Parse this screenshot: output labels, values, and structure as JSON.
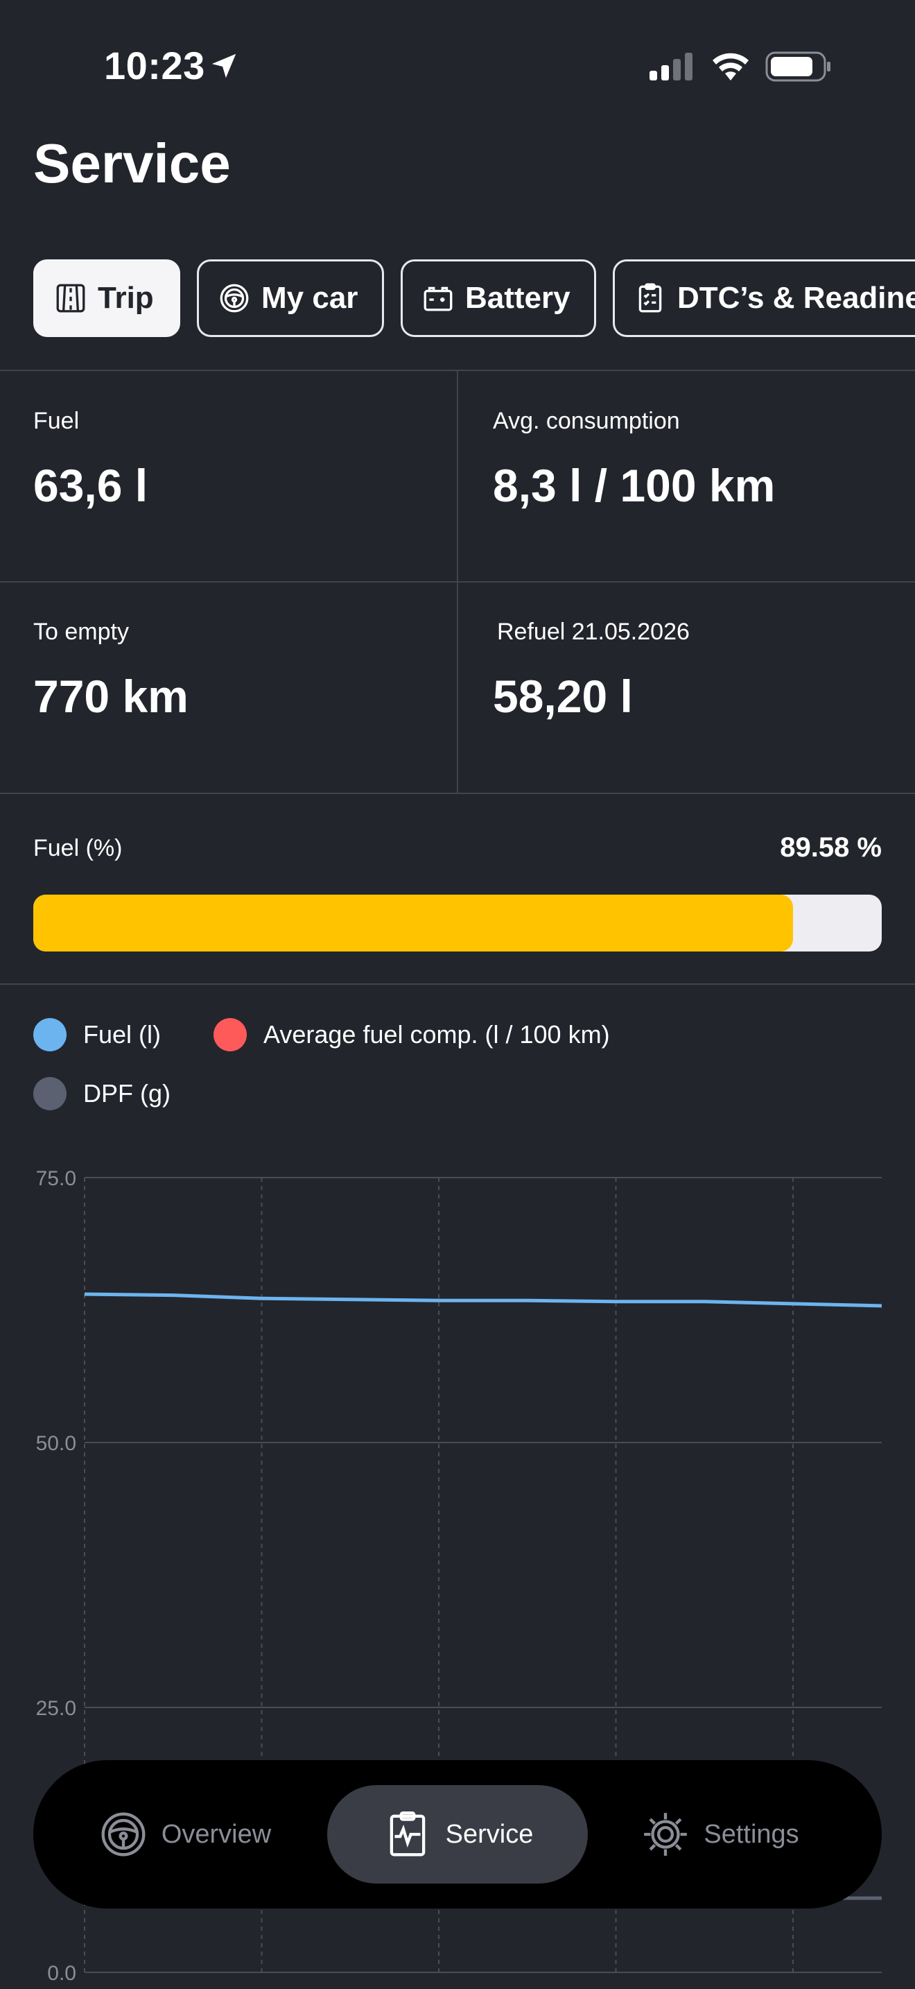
{
  "status_bar": {
    "time": "10:23"
  },
  "header": {
    "title": "Service"
  },
  "tabs": [
    {
      "label": "Trip",
      "icon": "road-icon",
      "active": true
    },
    {
      "label": "My car",
      "icon": "steering-wheel-icon",
      "active": false
    },
    {
      "label": "Battery",
      "icon": "battery-icon",
      "active": false
    },
    {
      "label": "DTC’s & Readiness",
      "icon": "clipboard-icon",
      "active": false
    }
  ],
  "stats": {
    "fuel": {
      "label": "Fuel",
      "value": "63,6 l"
    },
    "avg_consumption": {
      "label": "Avg. consumption",
      "value": "8,3 l / 100 km"
    },
    "to_empty": {
      "label": "To empty",
      "value": "770 km"
    },
    "refuel": {
      "label": "Refuel 21.05.2026",
      "value": "58,20 l"
    }
  },
  "fuel_level": {
    "label": "Fuel (%)",
    "value_text": "89.58 %",
    "fraction": 0.8958
  },
  "legend": [
    {
      "label": "Fuel (l)",
      "color": "#6cb4f0"
    },
    {
      "label": "Average fuel comp. (l / 100 km)",
      "color": "#ff5a5a"
    },
    {
      "label": "DPF (g)",
      "color": "#5b6170"
    }
  ],
  "chart_data": {
    "type": "line",
    "ylim": [
      0,
      75
    ],
    "y_ticks": [
      "75.0",
      "50.0",
      "25.0",
      "0.0"
    ],
    "grid": true,
    "series": [
      {
        "name": "Fuel (l)",
        "color": "#6cb4f0",
        "values": [
          64.0,
          63.9,
          63.6,
          63.5,
          63.4,
          63.4,
          63.3,
          63.3,
          63.1,
          62.9
        ]
      },
      {
        "name": "DPF (g)",
        "color": "#5b6170",
        "values": [
          7.0,
          7.0,
          7.0,
          7.0,
          7.0,
          7.0,
          7.0,
          7.0,
          7.0,
          7.0
        ]
      }
    ]
  },
  "bottom_nav": [
    {
      "label": "Overview",
      "icon": "steering-wheel-icon",
      "active": false
    },
    {
      "label": "Service",
      "icon": "clipboard-pulse-icon",
      "active": true
    },
    {
      "label": "Settings",
      "icon": "gear-icon",
      "active": false
    }
  ],
  "colors": {
    "background": "#23252d",
    "accent": "#ffc300",
    "divider": "#41444d"
  }
}
